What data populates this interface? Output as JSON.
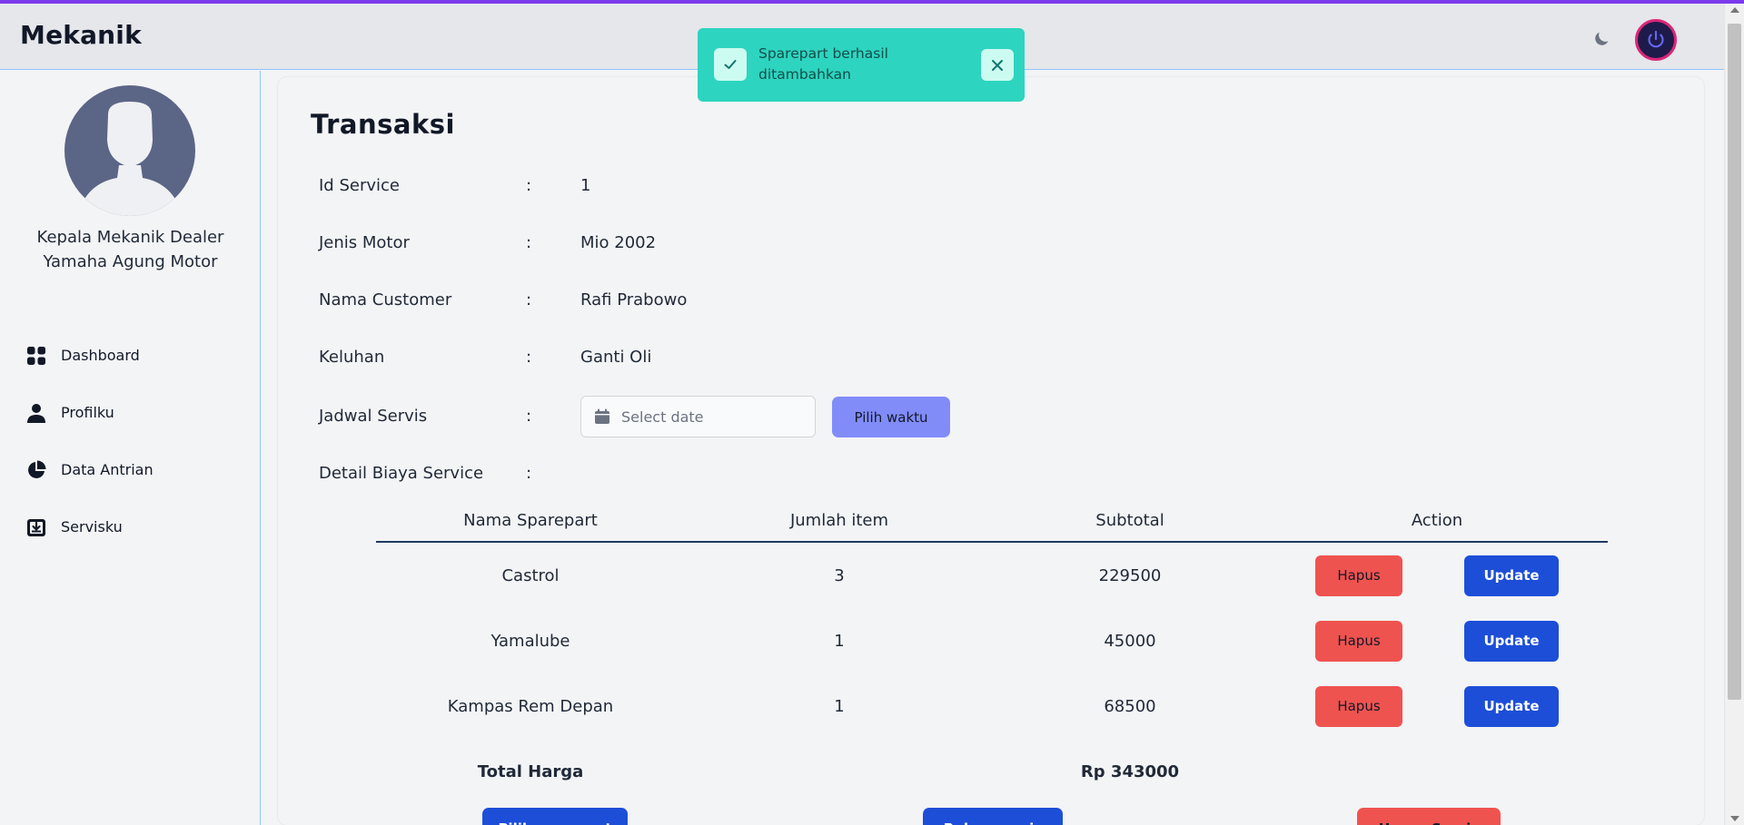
{
  "app": {
    "brand": "Mekanik"
  },
  "header": {
    "theme_icon": "moon-icon",
    "power_icon": "power-icon"
  },
  "toast": {
    "message": "Sparepart berhasil ditambahkan",
    "icon": "check-icon",
    "close_icon": "close-icon"
  },
  "sidebar": {
    "profile_name": "Kepala Mekanik Dealer Yamaha Agung Motor",
    "items": [
      {
        "label": "Dashboard",
        "icon": "grid-icon"
      },
      {
        "label": "Profilku",
        "icon": "user-icon"
      },
      {
        "label": "Data Antrian",
        "icon": "pie-chart-icon"
      },
      {
        "label": "Servisku",
        "icon": "download-box-icon"
      }
    ]
  },
  "main": {
    "title": "Transaksi",
    "fields": [
      {
        "label": "Id Service",
        "colon": ":",
        "value": "1"
      },
      {
        "label": "Jenis Motor",
        "colon": ":",
        "value": "Mio 2002"
      },
      {
        "label": "Nama Customer",
        "colon": ":",
        "value": "Rafi Prabowo"
      },
      {
        "label": "Keluhan",
        "colon": ":",
        "value": "Ganti Oli"
      },
      {
        "label": "Jadwal Servis",
        "colon": ":",
        "value": ""
      },
      {
        "label": "Detail Biaya Service",
        "colon": ":",
        "value": ""
      }
    ],
    "date_placeholder": "Select date",
    "pick_time_label": "Pilih waktu",
    "table": {
      "headers": [
        "Nama Sparepart",
        "Jumlah item",
        "Subtotal",
        "Action"
      ],
      "rows": [
        {
          "name": "Castrol",
          "qty": "3",
          "subtotal": "229500",
          "delete_label": "Hapus",
          "update_label": "Update"
        },
        {
          "name": "Yamalube",
          "qty": "1",
          "subtotal": "45000",
          "delete_label": "Hapus",
          "update_label": "Update"
        },
        {
          "name": "Kampas Rem Depan",
          "qty": "1",
          "subtotal": "68500",
          "delete_label": "Hapus",
          "update_label": "Update"
        }
      ],
      "total_label": "Total Harga",
      "total_value": "Rp 343000"
    },
    "bottom_buttons": [
      "Pilih sparepart",
      "Bukan servis",
      "Hapus Servis"
    ]
  },
  "colors": {
    "accent": "#1d4ed8",
    "danger": "#ef5350",
    "secondary": "#818cf8",
    "toast": "#2dd4bf"
  }
}
